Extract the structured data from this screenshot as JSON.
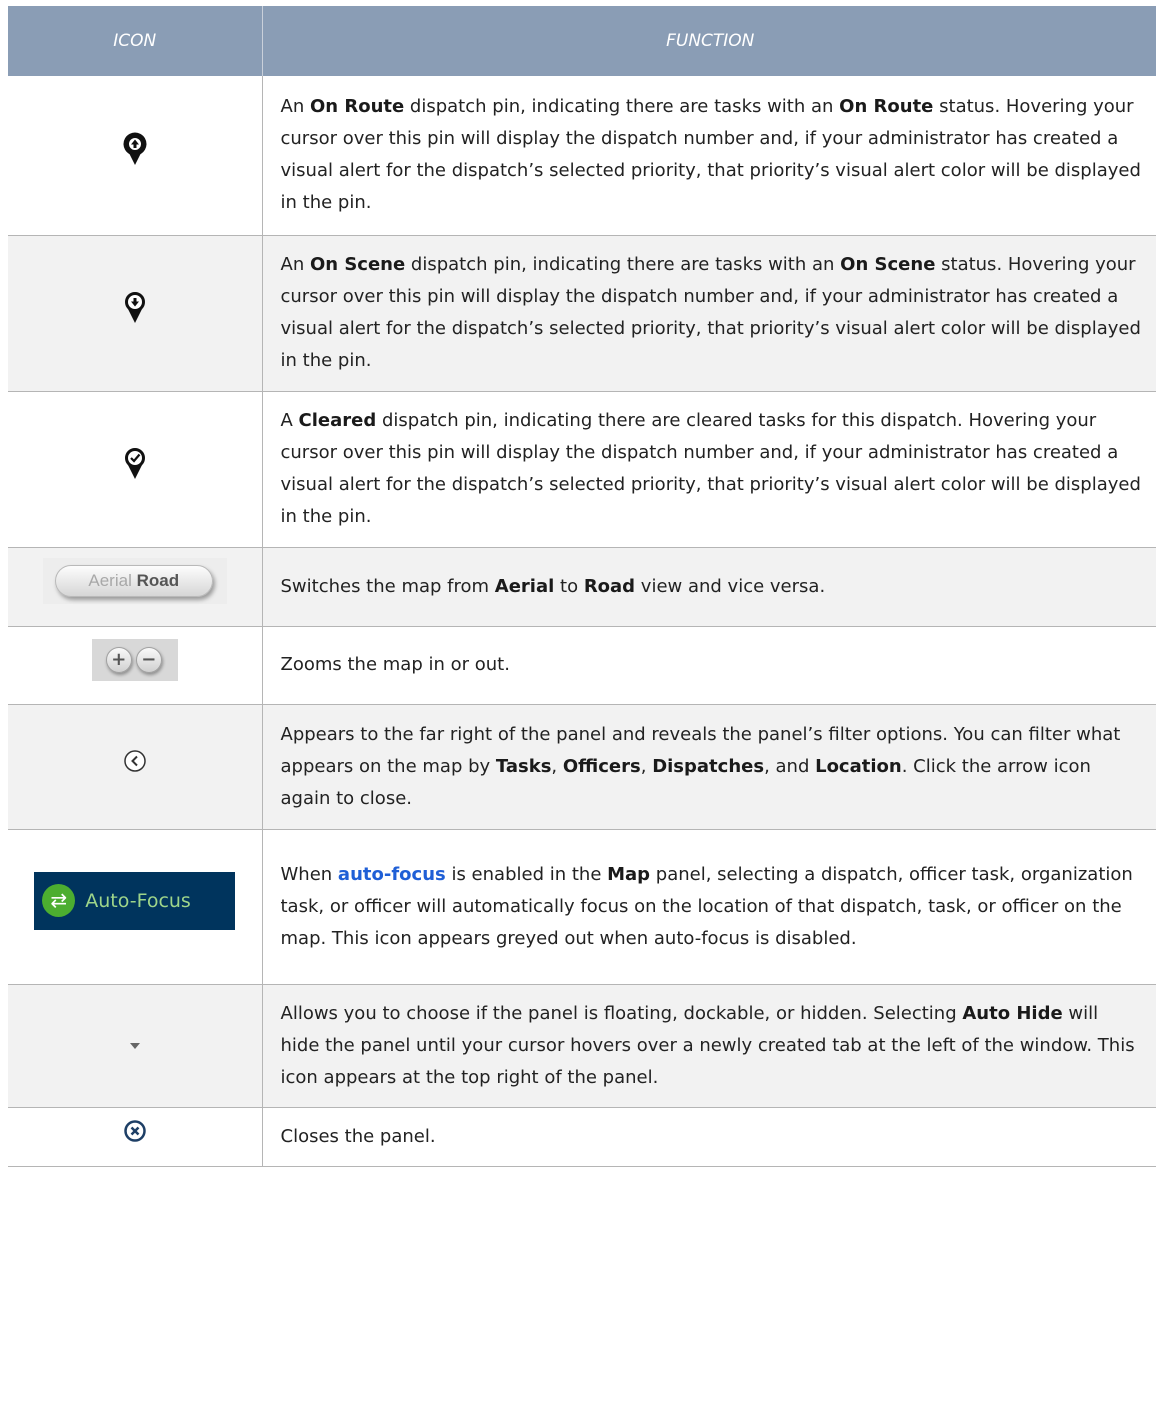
{
  "header": {
    "icon_col": "ICON",
    "function_col": "FUNCTION"
  },
  "rows": [
    {
      "icon": "on-route-pin-icon",
      "parts": [
        {
          "t": "An "
        },
        {
          "t": "On Route",
          "b": true
        },
        {
          "t": " dispatch pin, indicating there are tasks with an "
        },
        {
          "t": "On Route",
          "b": true
        },
        {
          "t": " status. Hovering your cursor over this pin will display the dispatch number and, if your administrator has created a visual alert for the dispatch’s selected priority, that priority’s visual alert color will be displayed in the pin."
        }
      ]
    },
    {
      "icon": "on-scene-pin-icon",
      "parts": [
        {
          "t": "An "
        },
        {
          "t": "On Scene",
          "b": true
        },
        {
          "t": " dispatch pin, indicating there are tasks with an "
        },
        {
          "t": "On Scene",
          "b": true
        },
        {
          "t": " status. Hovering your cursor over this pin will display the dispatch number and, if your administrator has created a visual alert for the dispatch’s selected priority, that priority’s visual alert color will be displayed in the pin."
        }
      ]
    },
    {
      "icon": "cleared-pin-icon",
      "parts": [
        {
          "t": "A "
        },
        {
          "t": "Cleared",
          "b": true
        },
        {
          "t": " dispatch pin, indicating there are cleared tasks for this dispatch. Hovering your cursor over this pin will display the dispatch number and, if your administrator has created a visual alert for the dispatch’s selected priority, that priority’s visual alert color will be displayed in the pin."
        }
      ]
    },
    {
      "icon": "aerial-road-toggle-icon",
      "icon_text": {
        "aerial": "Aerial",
        "road": "Road"
      },
      "parts": [
        {
          "t": "Switches the map from "
        },
        {
          "t": "Aerial",
          "b": true
        },
        {
          "t": " to "
        },
        {
          "t": "Road",
          "b": true
        },
        {
          "t": " view and vice versa."
        }
      ]
    },
    {
      "icon": "zoom-in-out-icon",
      "parts": [
        {
          "t": "Zooms the map in or out."
        }
      ]
    },
    {
      "icon": "filter-arrow-icon",
      "parts": [
        {
          "t": "Appears to the far right of the panel and reveals the panel’s filter options. You can filter what appears on the map by "
        },
        {
          "t": "Tasks",
          "b": true
        },
        {
          "t": ", "
        },
        {
          "t": "Officers",
          "b": true
        },
        {
          "t": ", "
        },
        {
          "t": "Dispatches",
          "b": true
        },
        {
          "t": ", and "
        },
        {
          "t": "Location",
          "b": true
        },
        {
          "t": ". Click the arrow icon again to close."
        }
      ]
    },
    {
      "icon": "auto-focus-icon",
      "icon_text": {
        "label": "Auto-Focus"
      },
      "parts": [
        {
          "t": "When "
        },
        {
          "t": "auto-focus",
          "link": true
        },
        {
          "t": " is enabled in the "
        },
        {
          "t": "Map",
          "b": true
        },
        {
          "t": " panel, selecting a dispatch, officer task, organization task, or officer will automatically focus on the location of that dispatch, task, or officer on the map. This icon appears greyed out when auto-focus is disabled."
        }
      ]
    },
    {
      "icon": "dropdown-arrow-icon",
      "parts": [
        {
          "t": "Allows you to choose if the panel is floating, dockable, or hidden. Selecting "
        },
        {
          "t": "Auto Hide",
          "b": true
        },
        {
          "t": " will hide the panel until your cursor hovers over a newly created tab at the left of the window. This icon appears at the top right of the panel."
        }
      ]
    },
    {
      "icon": "close-panel-icon",
      "parts": [
        {
          "t": "Closes the panel."
        }
      ]
    }
  ],
  "colors": {
    "header_bg": "#8a9db5",
    "alt_row_bg": "#f2f2f2",
    "link": "#1f5fd6",
    "auto_focus_bg": "#00345d",
    "auto_focus_green": "#4cae30"
  }
}
